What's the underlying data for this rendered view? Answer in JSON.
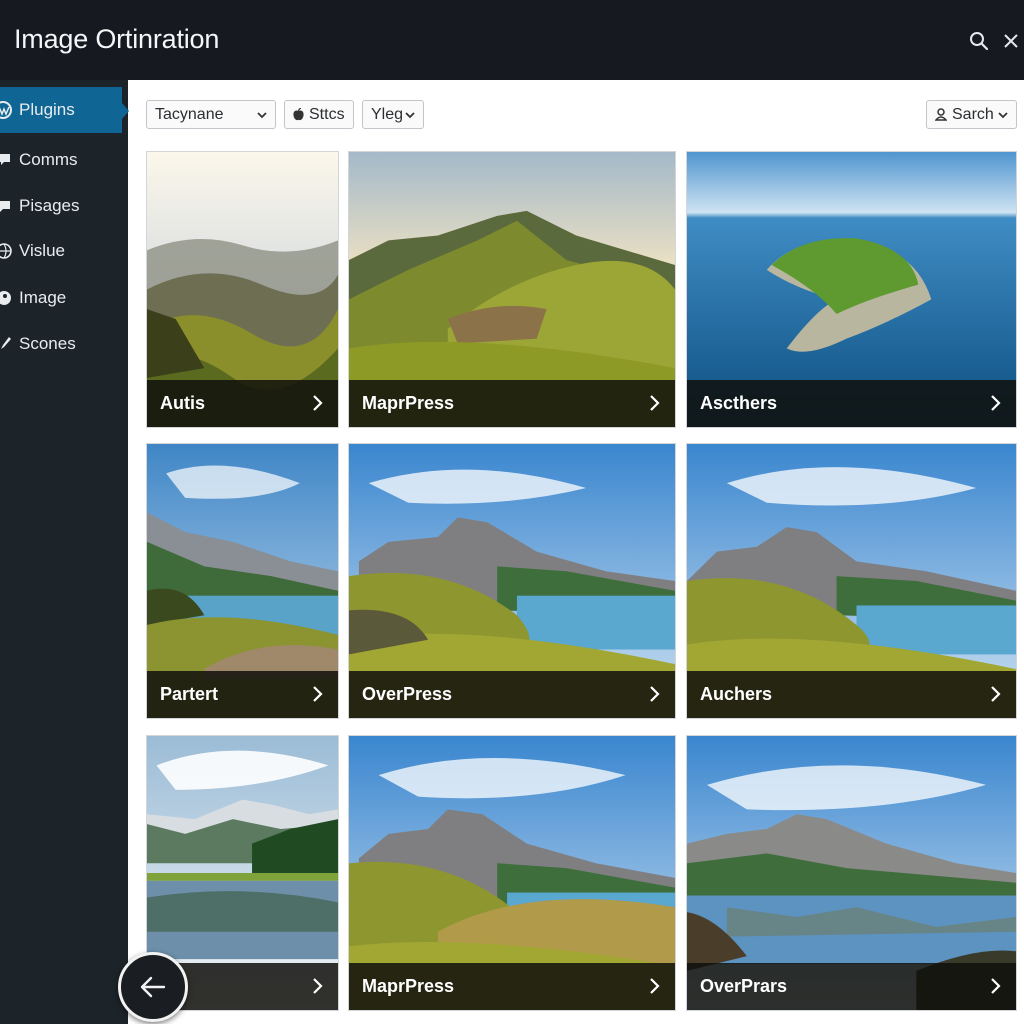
{
  "header": {
    "title": "Image Ortinration",
    "search_icon": "search-icon",
    "close_icon": "close-icon"
  },
  "sidebar": {
    "items": [
      {
        "label": "Plugins",
        "icon": "wordpress-icon",
        "active": true
      },
      {
        "label": "Comms",
        "icon": "comment-icon",
        "active": false
      },
      {
        "label": "Pisages",
        "icon": "pages-icon",
        "active": false
      },
      {
        "label": "Vislue",
        "icon": "globe-icon",
        "active": false
      },
      {
        "label": "Image",
        "icon": "image-icon",
        "active": false
      },
      {
        "label": "Scones",
        "icon": "brush-icon",
        "active": false
      }
    ]
  },
  "toolbar": {
    "filter_select": "Tacynane",
    "stats_label": "Sttcs",
    "view_select": "Yleg",
    "search_label": "Sarch"
  },
  "gallery": {
    "cards": [
      {
        "name": "Autis",
        "scene": "sunrise-hills"
      },
      {
        "name": "MaprPress",
        "scene": "green-peak"
      },
      {
        "name": "Ascthers",
        "scene": "aerial-island"
      },
      {
        "name": "Partert",
        "scene": "lake-cliffs"
      },
      {
        "name": "OverPress",
        "scene": "lake-mountain"
      },
      {
        "name": "Auchers",
        "scene": "lake-mountain"
      },
      {
        "name": "",
        "scene": "alpine-lake"
      },
      {
        "name": "MaprPress",
        "scene": "lake-mountain"
      },
      {
        "name": "OverPrars",
        "scene": "reflection-lake"
      }
    ]
  },
  "colors": {
    "header_bg": "#161a20",
    "sidebar_bg": "#1c2329",
    "active_item": "#0f6593"
  }
}
